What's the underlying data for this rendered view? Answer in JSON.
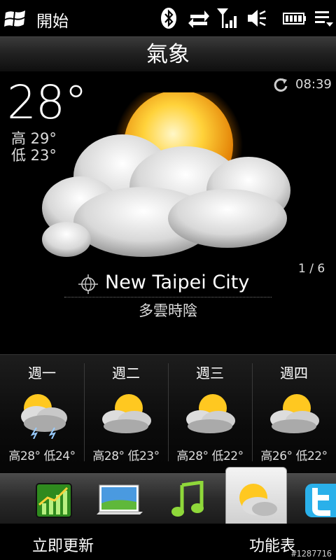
{
  "status_bar": {
    "start_label": "開始",
    "icons": [
      "windows-flag-icon",
      "bluetooth-icon",
      "data-sync-icon",
      "signal-icon",
      "volume-icon",
      "battery-icon",
      "menu-icon"
    ]
  },
  "title": "氣象",
  "current": {
    "temperature": "28°",
    "high": "高 29°",
    "low": "低 23°",
    "update_time": "08:39",
    "page_indicator": "1 / 6",
    "city": "New Taipei City",
    "condition": "多雲時陰",
    "icon": "partly-cloudy-sun-icon"
  },
  "forecast": [
    {
      "day": "週一",
      "temps": "高28° 低24°",
      "icon": "thunderstorm-sun-icon"
    },
    {
      "day": "週二",
      "temps": "高28° 低23°",
      "icon": "partly-cloudy-sun-icon"
    },
    {
      "day": "週三",
      "temps": "高28° 低22°",
      "icon": "partly-cloudy-sun-icon"
    },
    {
      "day": "週四",
      "temps": "高26° 低22°",
      "icon": "partly-cloudy-sun-icon"
    }
  ],
  "tabs": [
    {
      "name": "stocks-tab",
      "icon": "stocks-icon"
    },
    {
      "name": "photos-tab",
      "icon": "photos-icon"
    },
    {
      "name": "music-tab",
      "icon": "music-icon"
    },
    {
      "name": "weather-tab",
      "icon": "weather-icon",
      "selected": true
    },
    {
      "name": "twitter-tab",
      "icon": "twitter-icon"
    }
  ],
  "softkeys": {
    "left": "立即更新",
    "right": "功能表"
  },
  "watermark": "#1287716"
}
